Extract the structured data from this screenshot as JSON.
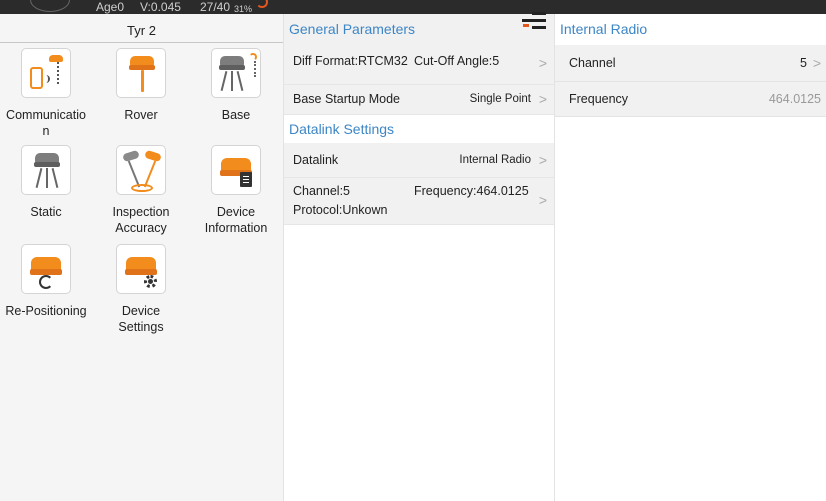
{
  "status": {
    "age": "Age0",
    "precision": "V:0.045",
    "satellites": "27/40",
    "battery": "31%"
  },
  "left_panel": {
    "device_name": "Tyr 2",
    "tiles": [
      {
        "label": "Communicatio\nn",
        "icon": "communication-icon"
      },
      {
        "label": "Rover",
        "icon": "rover-icon"
      },
      {
        "label": "Base",
        "icon": "base-icon"
      },
      {
        "label": "Static",
        "icon": "static-icon"
      },
      {
        "label": "Inspection\nAccuracy",
        "icon": "inspection-accuracy-icon"
      },
      {
        "label": "Device\nInformation",
        "icon": "device-information-icon"
      },
      {
        "label": "Re-Positioning",
        "icon": "re-positioning-icon"
      },
      {
        "label": "Device\nSettings",
        "icon": "device-settings-icon"
      }
    ]
  },
  "middle_panel": {
    "general_header": "General Parameters",
    "diff_format": "Diff Format:RTCM32",
    "cutoff_angle": "Cut-Off Angle:5",
    "base_startup_label": "Base Startup Mode",
    "base_startup_value": "Single Point",
    "datalink_header": "Datalink Settings",
    "datalink_label": "Datalink",
    "datalink_value": "Internal Radio",
    "channel": "Channel:5",
    "frequency": "Frequency:464.0125",
    "protocol": "Protocol:Unkown",
    "chevron": ">"
  },
  "right_panel": {
    "header": "Internal Radio",
    "channel_label": "Channel",
    "channel_value": "5",
    "frequency_label": "Frequency",
    "frequency_value": "464.0125",
    "chevron": ">"
  },
  "colors": {
    "accent_blue": "#3d86c6",
    "receiver_orange": "#f28c1c",
    "header_bg": "#f1f1f1"
  }
}
